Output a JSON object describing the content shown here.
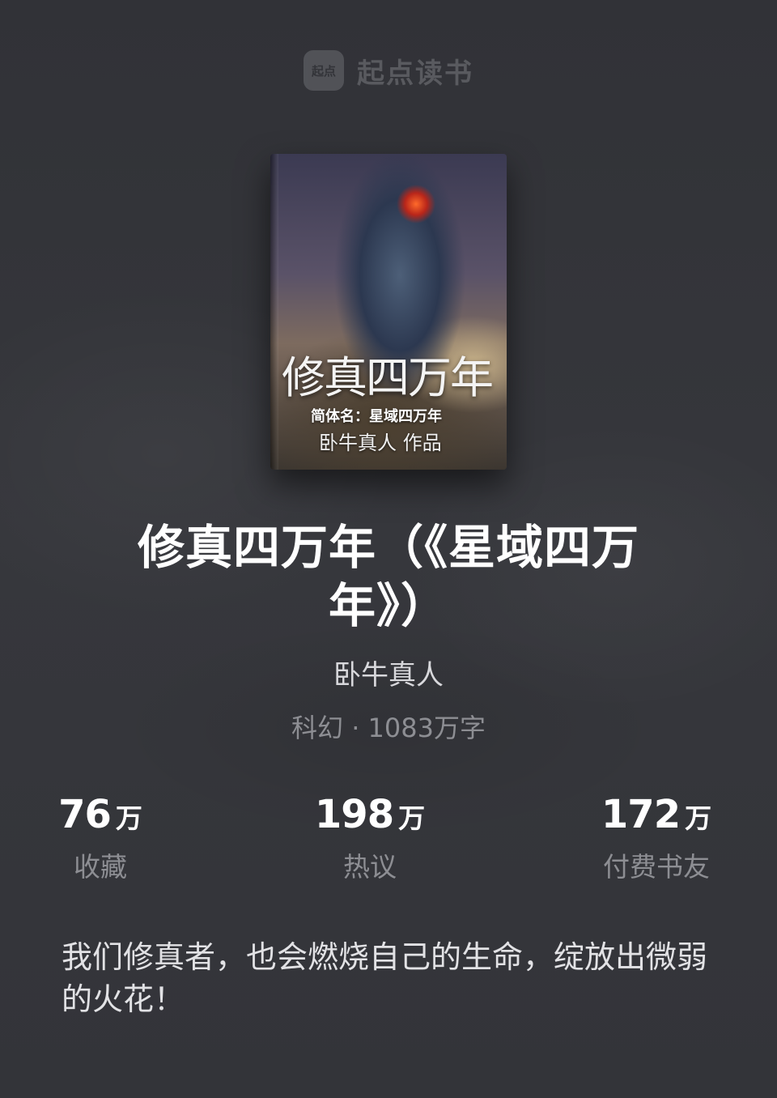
{
  "brand": {
    "logo_text": "起点",
    "name": "起点读书"
  },
  "cover": {
    "title": "修真四万年",
    "subtitle": "简体名：星域四万年",
    "author_line": "卧牛真人 作品"
  },
  "book": {
    "title": "修真四万年（《星域四万年》）",
    "author": "卧牛真人",
    "meta": "科幻 · 1083万字"
  },
  "stats": [
    {
      "value": "76",
      "unit": "万",
      "label": "收藏"
    },
    {
      "value": "198",
      "unit": "万",
      "label": "热议"
    },
    {
      "value": "172",
      "unit": "万",
      "label": "付费书友"
    }
  ],
  "intro": "我们修真者，也会燃烧自己的生命，绽放出微弱的火花！"
}
